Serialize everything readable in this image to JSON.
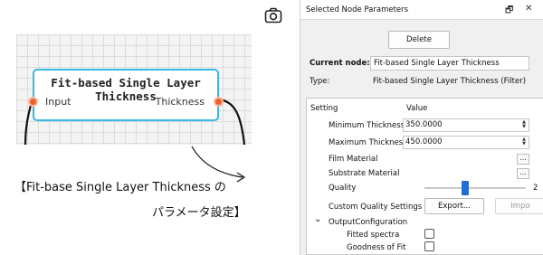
{
  "node": {
    "title": "Fit-based Single Layer Thickness",
    "input_label": "Input",
    "output_label": "Thickness"
  },
  "caption": {
    "line1": "【Fit-base Single Layer Thickness の",
    "line2": "パラメータ設定】"
  },
  "panel": {
    "title": "Selected Node Parameters",
    "float_glyph": "🗗",
    "close_glyph": "✕",
    "delete_label": "Delete",
    "current_node_label": "Current node:",
    "current_node_value": "Fit-based Single Layer Thickness",
    "type_label": "Type:",
    "type_value": "Fit-based Single Layer Thickness (Filter)",
    "col_setting": "Setting",
    "col_value": "Value",
    "rows": {
      "min_thickness": {
        "label": "Minimum Thickness [nm]",
        "value": "350.0000"
      },
      "max_thickness": {
        "label": "Maximum Thickness [nm]",
        "value": "450.0000"
      },
      "film_material": {
        "label": "Film Material"
      },
      "substrate_material": {
        "label": "Substrate Material"
      },
      "quality": {
        "label": "Quality",
        "value_fraction": 0.4,
        "end_label": "2"
      },
      "custom_quality": {
        "label": "Custom Quality Settings",
        "export_label": "Export...",
        "import_label": "Impo"
      },
      "output_config": {
        "label": "OutputConfiguration",
        "chevron": "⌄"
      },
      "fitted_spectra": {
        "label": "Fitted spectra",
        "checked": false
      },
      "goodness_of_fit": {
        "label": "Goodness of Fit",
        "checked": false
      }
    },
    "dots_label": "..."
  },
  "colors": {
    "node_border": "#39b7e6",
    "port": "#e8642c",
    "slider_thumb": "#1f6fd1"
  }
}
